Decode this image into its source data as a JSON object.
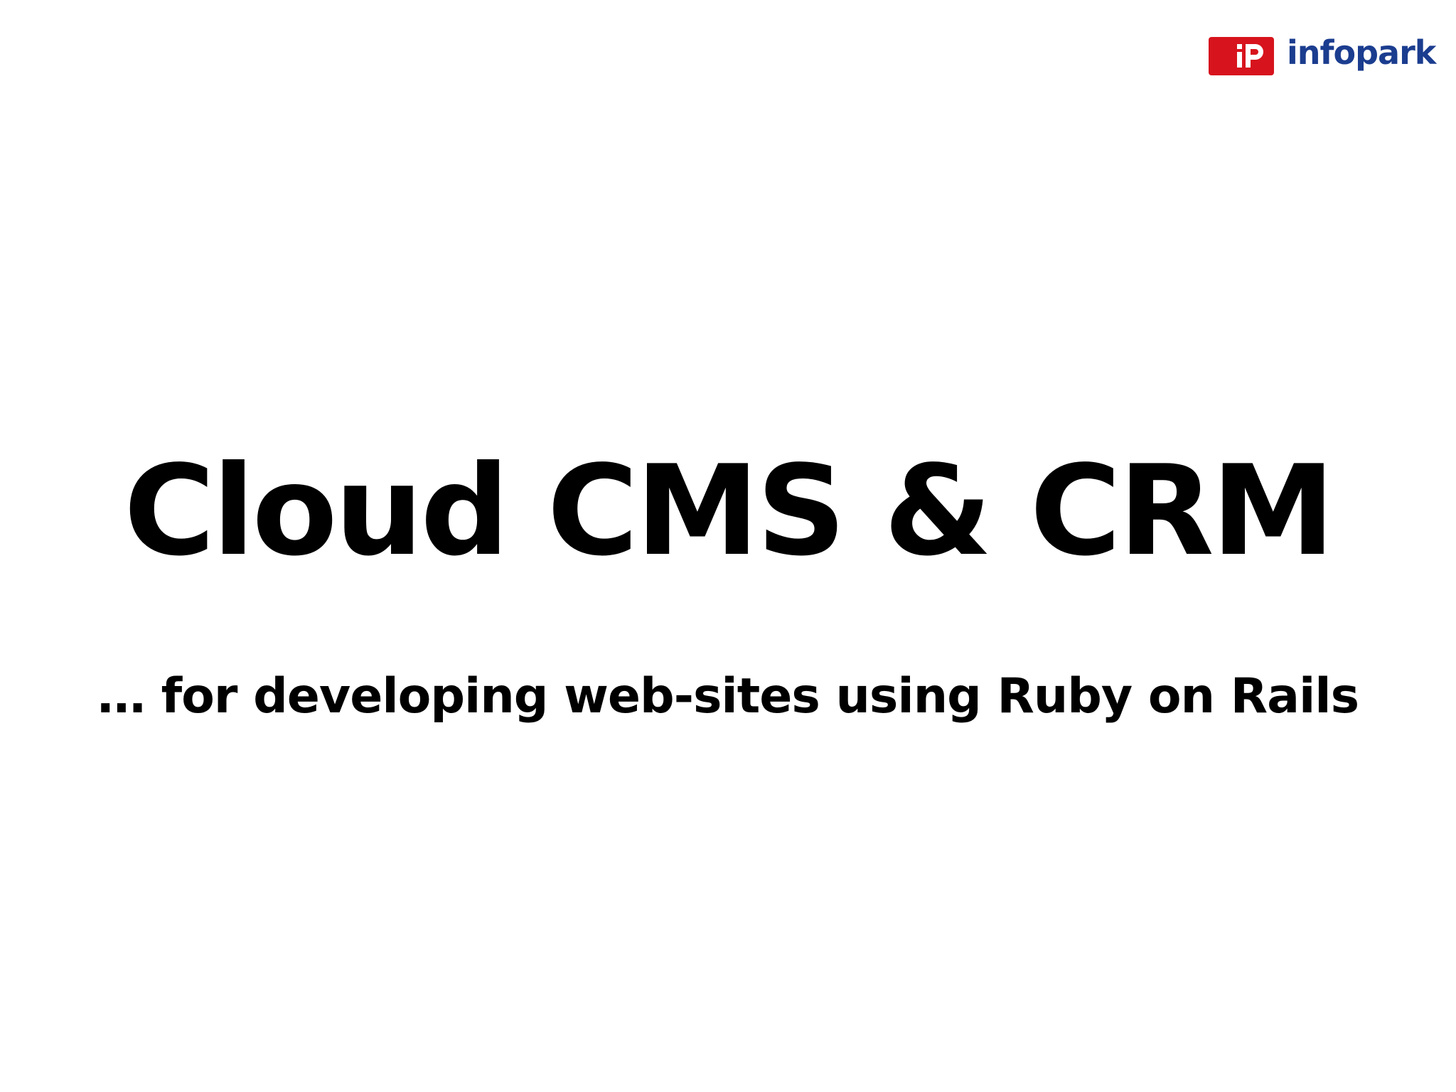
{
  "slide": {
    "title": "Cloud CMS & CRM",
    "subtitle": "… for developing web-sites using Ruby on Rails"
  },
  "logo": {
    "wordmark": "infopark",
    "mark_text": "iP",
    "icon": "infopark-logo-icon",
    "mark_color": "#d7141d",
    "word_color": "#1b3d8f"
  },
  "colors": {
    "background": "#ffffff",
    "text": "#000000"
  }
}
